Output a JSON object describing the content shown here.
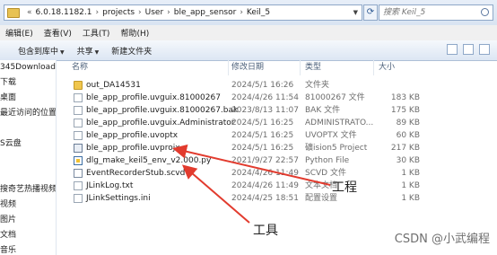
{
  "address": {
    "prefix": "«",
    "crumbs": [
      "6.0.18.1182.1",
      "projects",
      "User",
      "ble_app_sensor",
      "Keil_5"
    ],
    "search_placeholder": "搜索 Keil_5"
  },
  "menu": [
    "编辑(E)",
    "查看(V)",
    "工具(T)",
    "帮助(H)"
  ],
  "toolbar": {
    "include": "包含到库中",
    "share": "共享",
    "new_folder": "新建文件夹"
  },
  "nav": [
    "345Download:",
    "下载",
    "桌面",
    "最近访问的位置",
    "",
    "S云盘",
    "",
    "",
    "搜奇艺热播视频",
    "视频",
    "图片",
    "文档",
    "音乐"
  ],
  "columns": {
    "name": "名称",
    "date": "修改日期",
    "type": "类型",
    "size": "大小"
  },
  "files": [
    {
      "name": "out_DA14531",
      "date": "2024/5/1 16:26",
      "type": "文件夹",
      "size": "",
      "icon": "folder"
    },
    {
      "name": "ble_app_profile.uvguix.81000267",
      "date": "2024/4/26 11:54",
      "type": "81000267 文件",
      "size": "183 KB",
      "icon": "file"
    },
    {
      "name": "ble_app_profile.uvguix.81000267.bak",
      "date": "2023/8/13 11:07",
      "type": "BAK 文件",
      "size": "175 KB",
      "icon": "file"
    },
    {
      "name": "ble_app_profile.uvguix.Administrator",
      "date": "2024/5/1 16:25",
      "type": "ADMINISTRATO...",
      "size": "89 KB",
      "icon": "file"
    },
    {
      "name": "ble_app_profile.uvoptx",
      "date": "2024/5/1 16:25",
      "type": "UVOPTX 文件",
      "size": "60 KB",
      "icon": "file"
    },
    {
      "name": "ble_app_profile.uvprojx",
      "date": "2024/5/1 16:25",
      "type": "礦ision5 Project",
      "size": "217 KB",
      "icon": "keil"
    },
    {
      "name": "dlg_make_keil5_env_v2.000.py",
      "date": "2021/9/27 22:57",
      "type": "Python File",
      "size": "30 KB",
      "icon": "py"
    },
    {
      "name": "EventRecorderStub.scvd",
      "date": "2024/4/26 11:49",
      "type": "SCVD 文件",
      "size": "1 KB",
      "icon": "scvd"
    },
    {
      "name": "JLinkLog.txt",
      "date": "2024/4/26 11:49",
      "type": "文本文档",
      "size": "1 KB",
      "icon": "file"
    },
    {
      "name": "JLinkSettings.ini",
      "date": "2024/4/25 18:51",
      "type": "配置设置",
      "size": "1 KB",
      "icon": "file"
    }
  ],
  "annotations": {
    "project": "工程",
    "tool": "工具"
  },
  "watermark": "CSDN @小武编程",
  "colors": {
    "arrow": "#e23b2e",
    "header_text": "#4c607a",
    "meta_text": "#6d6d6d"
  }
}
